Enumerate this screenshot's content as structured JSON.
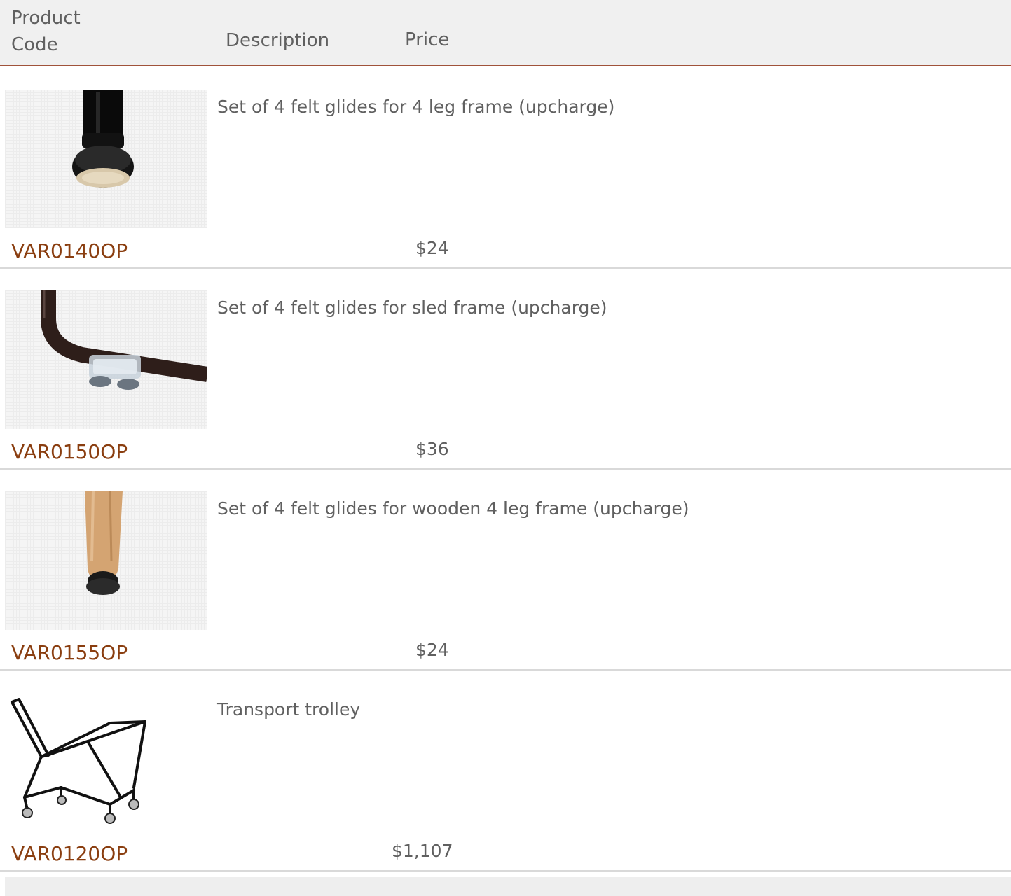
{
  "header": {
    "product_code_label": "Product Code",
    "description_label": "Description",
    "price_label": "Price"
  },
  "products": [
    {
      "code": "VAR0140OP",
      "description": "Set of 4 felt glides for 4 leg frame (upcharge)",
      "price": "$24",
      "image_icon": "felt-glide-4-leg-image"
    },
    {
      "code": "VAR0150OP",
      "description": "Set of 4 felt glides for sled frame (upcharge)",
      "price": "$36",
      "image_icon": "felt-glide-sled-image"
    },
    {
      "code": "VAR0155OP",
      "description": "Set of 4 felt glides for wooden 4 leg frame (upcharge)",
      "price": "$24",
      "image_icon": "felt-glide-wooden-leg-image"
    },
    {
      "code": "VAR0120OP",
      "description": "Transport trolley",
      "price": "$1,107",
      "image_icon": "transport-trolley-image"
    }
  ],
  "colors": {
    "header_bg": "#f0f0f0",
    "header_rule": "#a0523a",
    "code_link": "#8a3e10",
    "row_divider": "#d9d9d9",
    "text": "#606060"
  }
}
